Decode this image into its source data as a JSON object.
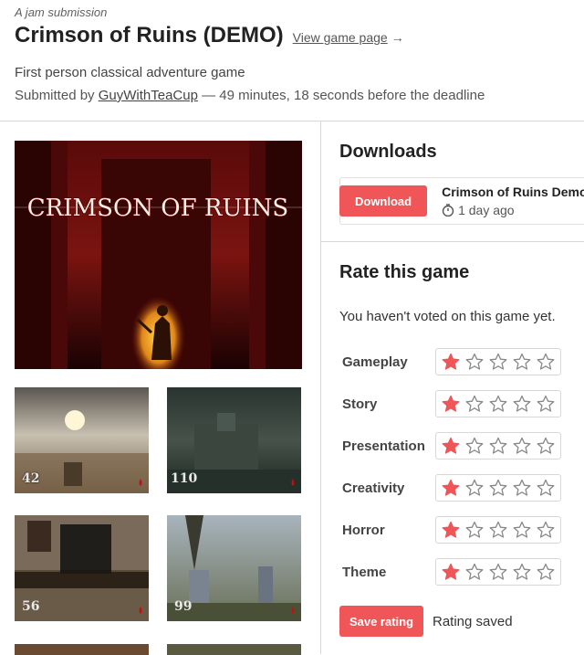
{
  "header": {
    "jam_label": "A jam submission",
    "title": "Crimson of Ruins (DEMO)",
    "view_link": "View game page",
    "view_arrow": "→",
    "tagline": "First person classical adventure game",
    "submitted_prefix": "Submitted by",
    "author": "GuyWithTeaCup",
    "submitted_suffix": "— 49 minutes, 18 seconds before the deadline"
  },
  "media": {
    "cover_title": "CRIMSON OF RUINS",
    "screenshots": [
      {
        "overlay": "42"
      },
      {
        "overlay": "110"
      },
      {
        "overlay": "56"
      },
      {
        "overlay": "99"
      }
    ]
  },
  "downloads": {
    "heading": "Downloads",
    "button_label": "Download",
    "file_name": "Crimson of Ruins Demo",
    "age": "1 day ago"
  },
  "rating": {
    "heading": "Rate this game",
    "hint": "You haven't voted on this game yet.",
    "criteria": [
      {
        "label": "Gameplay",
        "stars": 1
      },
      {
        "label": "Story",
        "stars": 1
      },
      {
        "label": "Presentation",
        "stars": 1
      },
      {
        "label": "Creativity",
        "stars": 1
      },
      {
        "label": "Horror",
        "stars": 1
      },
      {
        "label": "Theme",
        "stars": 1
      }
    ],
    "max_stars": 5,
    "save_label": "Save rating",
    "status": "Rating saved"
  },
  "colors": {
    "accent": "#f05557",
    "star_filled": "#f05557",
    "star_empty": "#888888"
  }
}
